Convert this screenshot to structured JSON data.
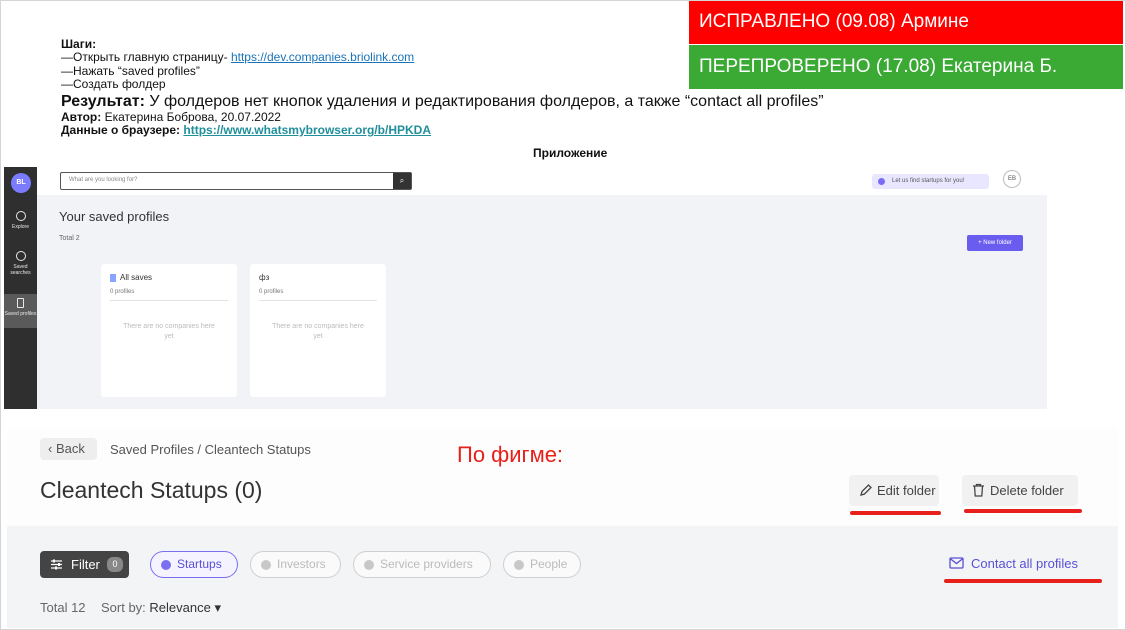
{
  "banners": {
    "fixed": "ИСПРАВЛЕНО (09.08) Армине",
    "rechecked": "ПЕРЕПРОВЕРЕНО (17.08) Екатерина Б."
  },
  "report": {
    "steps_label": "Шаги:",
    "step1_text": "—Открыть главную страницу- ",
    "step1_link": "https://dev.companies.briolink.com",
    "step2": "—Нажать “saved profiles”",
    "step3": "—Создать фолдер",
    "result_label": "Результат:",
    "result_text": " У фолдеров нет кнопок удаления и редактирования фолдеров, а также “contact all profiles”",
    "author_label": "Автор:",
    "author_value": " Екатерина Боброва, 20.07.2022",
    "browser_label": "Данные о браузере:",
    "browser_link": "https://www.whatsmybrowser.org/b/HPKDA",
    "attachment_label": "Приложение"
  },
  "app": {
    "logo": "BL",
    "sidebar": [
      {
        "label": "Explore"
      },
      {
        "label": "Saved searches"
      },
      {
        "label": "Saved profiles"
      }
    ],
    "search_placeholder": "What are you looking for?",
    "search_button": "⌕",
    "help_text": "Let us find startups for you!",
    "avatar": "EB",
    "title": "Your saved profiles",
    "total": "Total 2",
    "new_folder": "+ New folder",
    "cards": [
      {
        "name": "All saves",
        "count": "0 profiles",
        "empty": "There are no companies here yet"
      },
      {
        "name": "фз",
        "count": "0 profiles",
        "empty": "There are no companies here yet"
      }
    ]
  },
  "figma": {
    "annotation": "По фигме:",
    "back": "Back",
    "breadcrumb": "Saved Profiles / Cleantech Statups",
    "title": "Cleantech Statups (0)",
    "edit_folder": "Edit folder",
    "delete_folder": "Delete folder",
    "filter": "Filter",
    "filter_count": "0",
    "tabs": [
      {
        "label": "Startups",
        "active": true
      },
      {
        "label": "Investors",
        "active": false
      },
      {
        "label": "Service providers",
        "active": false
      },
      {
        "label": "People",
        "active": false
      }
    ],
    "contact_all": "Contact all profiles",
    "total": "Total 12",
    "sort_label": "Sort by:",
    "sort_value": "Relevance ▾"
  },
  "colors": {
    "banner_red": "#ff0000",
    "banner_green": "#3aaa35",
    "accent": "#5a4fd6",
    "annotation_red": "#e8201b"
  }
}
